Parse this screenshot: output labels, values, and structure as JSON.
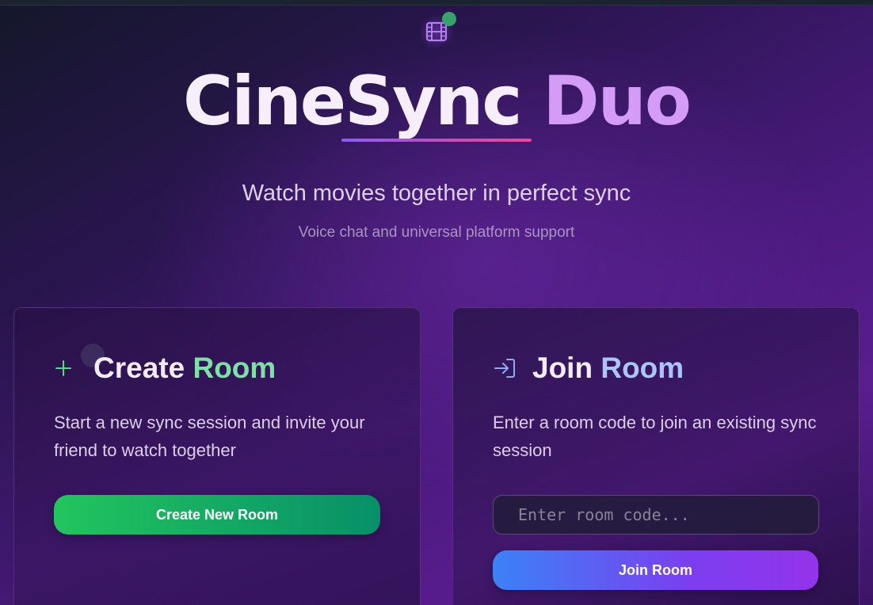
{
  "app": {
    "title_part1": "CineSync",
    "title_part2": "Duo",
    "subtitle": "Watch movies together in perfect sync",
    "tagline": "Voice chat and universal platform support",
    "logo_icon": "film-icon",
    "status_dot_color": "#36a36b"
  },
  "create_card": {
    "heading_word1": "Create",
    "heading_word2": "Room",
    "icon": "plus-icon",
    "description": "Start a new sync session and invite your friend to watch together",
    "button_label": "Create New Room",
    "accent_color": "#7fe0a6"
  },
  "join_card": {
    "heading_word1": "Join",
    "heading_word2": "Room",
    "icon": "login-arrow-icon",
    "description": "Enter a room code to join an existing sync session",
    "input_placeholder": "Enter room code...",
    "input_value": "",
    "button_label": "Join Room",
    "accent_color": "#a9c6f7"
  }
}
